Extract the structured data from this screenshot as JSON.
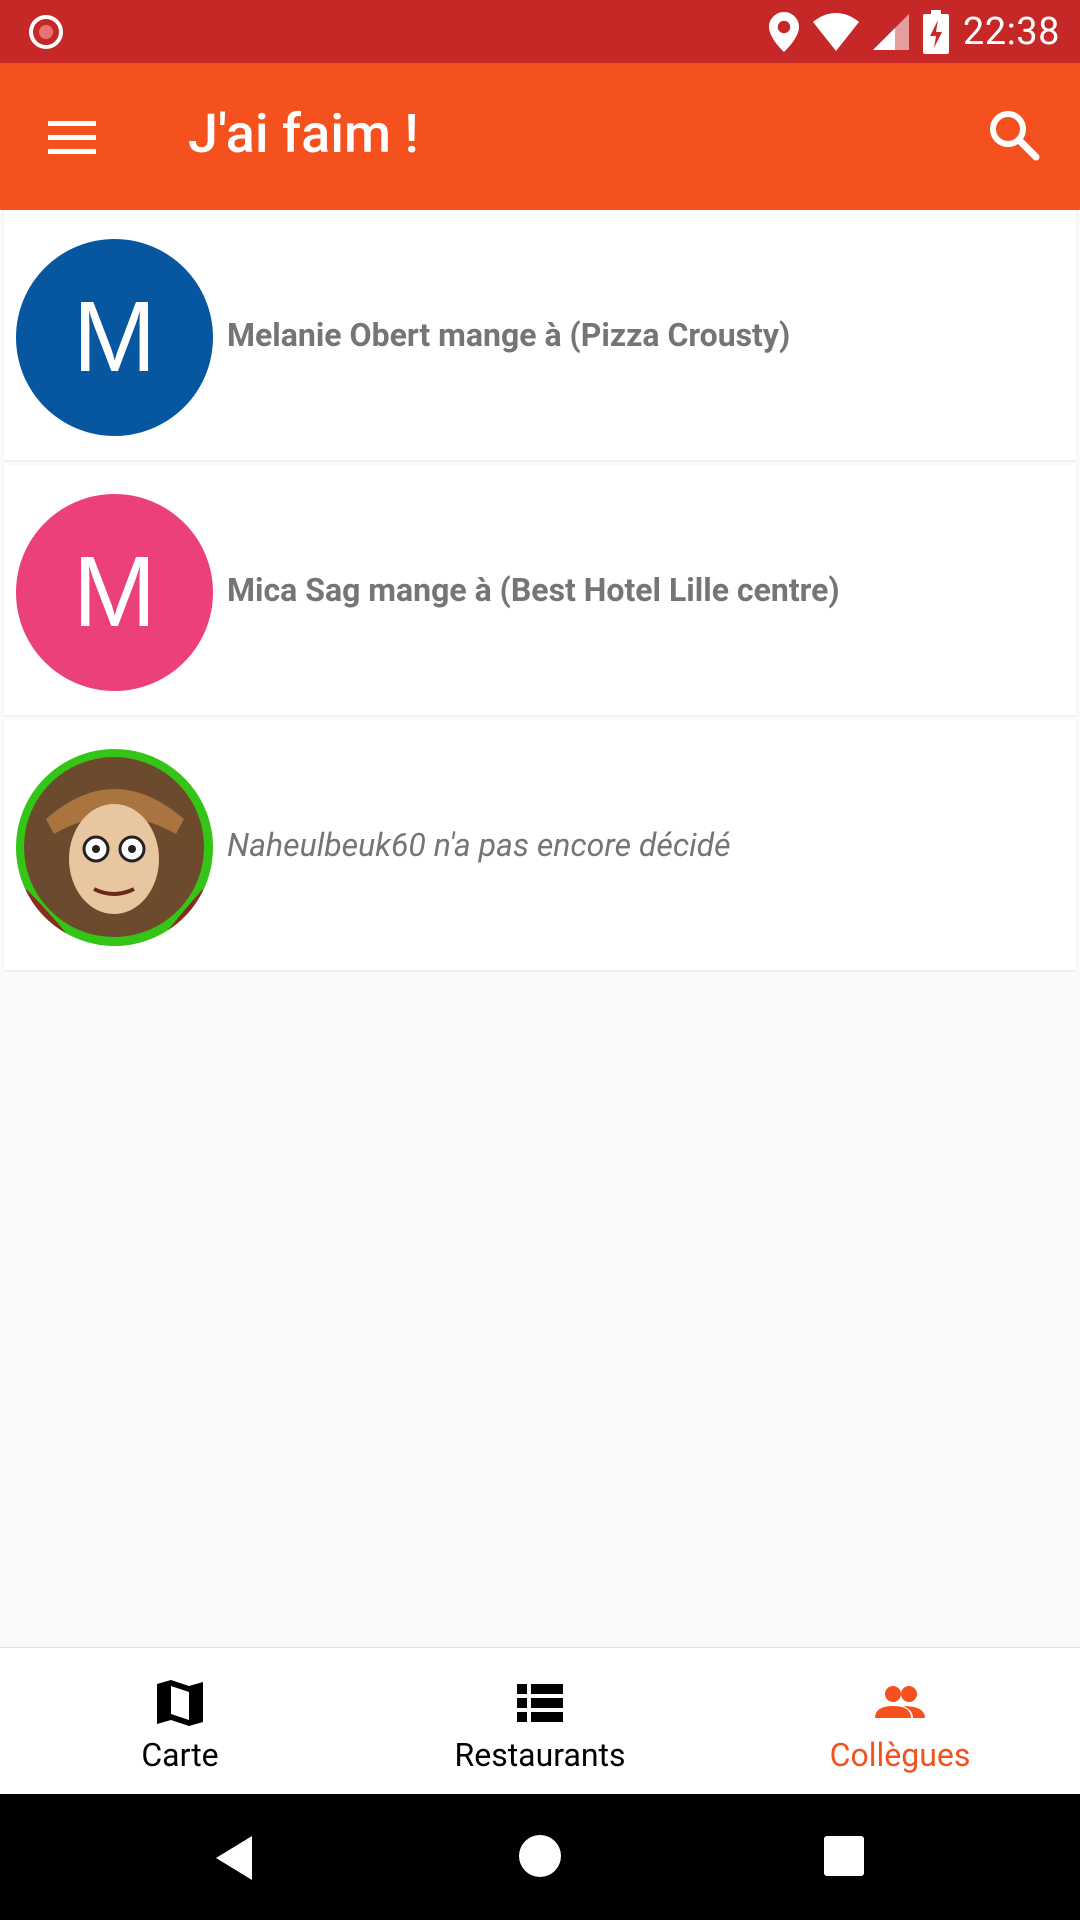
{
  "status_bar": {
    "time": "22:38",
    "icons": [
      "record-icon",
      "location-icon",
      "wifi-icon",
      "signal-icon",
      "battery-charging-icon"
    ]
  },
  "app_bar": {
    "title": "J'ai faim !",
    "menu_icon": "menu-icon",
    "search_icon": "search-icon",
    "color": "#f4511e"
  },
  "colleagues": [
    {
      "initial": "M",
      "avatar_color": "#0657a0",
      "text": "Melanie Obert mange à (Pizza Crousty)",
      "decided": true
    },
    {
      "initial": "M",
      "avatar_color": "#ec407a",
      "text": "Mica Sag mange à (Best Hotel Lille centre)",
      "decided": true
    },
    {
      "initial": "",
      "avatar_color": "#34c516",
      "text": "Naheulbeuk60 n'a pas encore décidé",
      "decided": false
    }
  ],
  "bottom_nav": {
    "items": [
      {
        "label": "Carte",
        "icon": "map-icon",
        "active": false
      },
      {
        "label": "Restaurants",
        "icon": "list-icon",
        "active": false
      },
      {
        "label": "Collègues",
        "icon": "people-icon",
        "active": true
      }
    ],
    "active_color": "#f4511e"
  },
  "system_nav": [
    "back-icon",
    "home-icon",
    "recents-icon"
  ]
}
